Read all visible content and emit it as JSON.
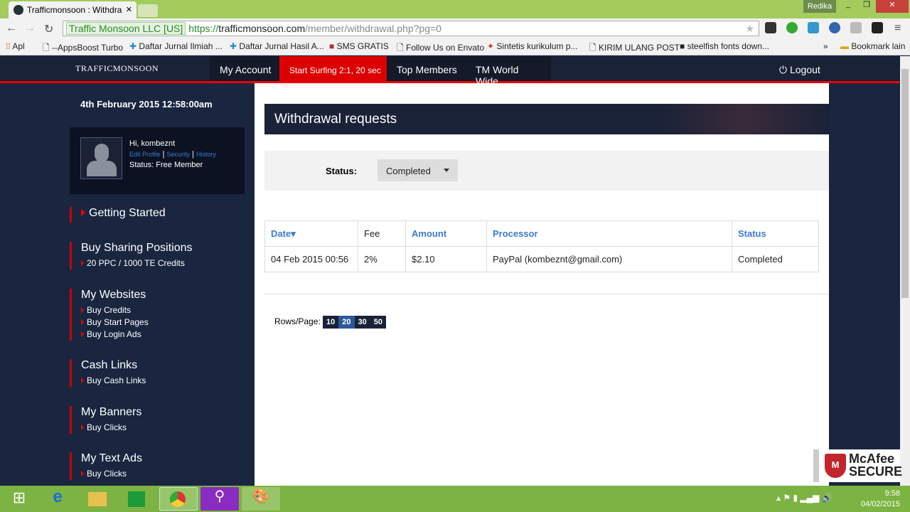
{
  "browser": {
    "tab_title": "Trafficmonsoon : Withdra",
    "user": "Redika",
    "ev_label": "Traffic Monsoon LLC [US]",
    "url_scheme": "https://",
    "url_host": "trafficmonsoon.com",
    "url_path": "/member/withdrawal.php?pg=0",
    "bookmarks": [
      "Apl",
      "--AppsBoost Turbo",
      "Daftar Jurnal Ilmiah ...",
      "Daftar Jurnal Hasil A...",
      "SMS GRATIS",
      "Follow Us on Envato",
      "Sintetis kurikulum p...",
      "KIRIM ULANG POST",
      "steelfish fonts down..."
    ],
    "more": "»",
    "other_bookmarks": "Bookmark lain"
  },
  "site": {
    "logo": "TRAFFICMONSOON",
    "nav": [
      "My Account",
      "Start Surfing 2:1, 20 sec",
      "Top Members",
      "TM World Wide"
    ],
    "logout": "Logout"
  },
  "sidebar": {
    "date": "4th February 2015 12:58:00am",
    "greeting": "Hi, kombeznt",
    "links": [
      "Edit Profile",
      "Security",
      "History"
    ],
    "status": "Status: Free Member",
    "sections": [
      {
        "title": "Getting Started",
        "items": []
      },
      {
        "title": "Buy Sharing Positions",
        "items": [
          "20 PPC / 1000 TE Credits"
        ]
      },
      {
        "title": "My Websites",
        "items": [
          "Buy Credits",
          "Buy Start Pages",
          "Buy Login Ads"
        ]
      },
      {
        "title": "Cash Links",
        "items": [
          "Buy Cash Links"
        ]
      },
      {
        "title": "My Banners",
        "items": [
          "Buy Clicks"
        ]
      },
      {
        "title": "My Text Ads",
        "items": [
          "Buy Clicks"
        ]
      }
    ]
  },
  "main": {
    "title": "Withdrawal requests",
    "status_label": "Status:",
    "status_value": "Completed",
    "columns": [
      "Date",
      "Fee",
      "Amount",
      "Processor",
      "Status"
    ],
    "rows": [
      [
        "04 Feb 2015 00:56",
        "2%",
        "$2.10",
        "PayPal (kombeznt@gmail.com)",
        "Completed"
      ]
    ],
    "rows_per_page_label": "Rows/Page:",
    "page_sizes": [
      "10",
      "20",
      "30",
      "50"
    ],
    "selected_page_size": "20"
  },
  "badge": {
    "text1": "McAfee",
    "text2": "SECURE"
  },
  "taskbar": {
    "time": "9:58",
    "date": "04/02/2015"
  }
}
